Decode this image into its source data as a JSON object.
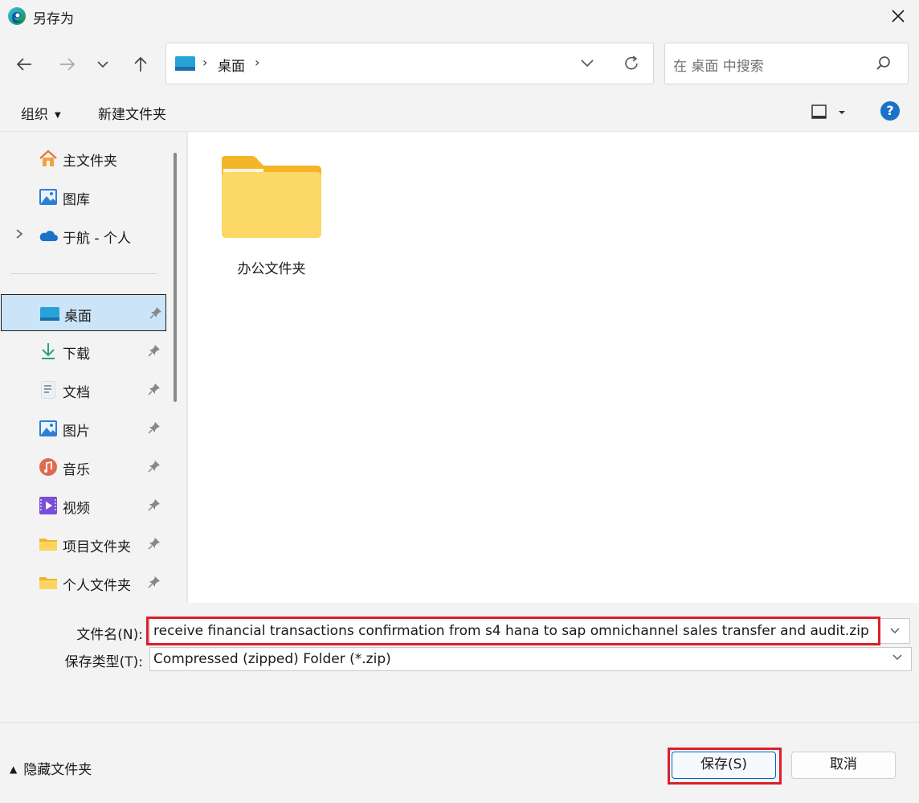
{
  "window": {
    "title": "另存为"
  },
  "address_bar": {
    "separator": "›",
    "crumb": "桌面",
    "trailing_separator": "›"
  },
  "search": {
    "placeholder": "在 桌面 中搜索"
  },
  "toolbar": {
    "organize_label": "组织",
    "new_folder_label": "新建文件夹"
  },
  "sidebar": {
    "items": [
      {
        "label": "主文件夹",
        "icon": "home-icon"
      },
      {
        "label": "图库",
        "icon": "gallery-icon"
      },
      {
        "label": "于航 - 个人",
        "icon": "onedrive-cloud-icon"
      },
      {
        "label": "桌面",
        "icon": "desktop-icon",
        "selected": true
      },
      {
        "label": "下载",
        "icon": "download-icon"
      },
      {
        "label": "文档",
        "icon": "document-icon"
      },
      {
        "label": "图片",
        "icon": "pictures-icon"
      },
      {
        "label": "音乐",
        "icon": "music-icon"
      },
      {
        "label": "视频",
        "icon": "video-icon"
      },
      {
        "label": "项目文件夹",
        "icon": "folder-icon"
      },
      {
        "label": "个人文件夹",
        "icon": "folder-icon"
      }
    ]
  },
  "content": {
    "items": [
      {
        "name": "办公文件夹",
        "type": "folder"
      }
    ]
  },
  "form": {
    "filename_label": "文件名(N):",
    "filename_value": "receive financial transactions confirmation from s4 hana to sap omnichannel sales transfer and audit.zip",
    "filetype_label": "保存类型(T):",
    "filetype_value": "Compressed (zipped) Folder (*.zip)"
  },
  "footer": {
    "hide_folders_label": "隐藏文件夹",
    "save_label": "保存(S)",
    "cancel_label": "取消"
  },
  "colors": {
    "accent": "#0067c0",
    "highlight_box": "#d9202b",
    "selected_bg": "#cce4f7",
    "folder_yellow": "#f8c83a"
  }
}
